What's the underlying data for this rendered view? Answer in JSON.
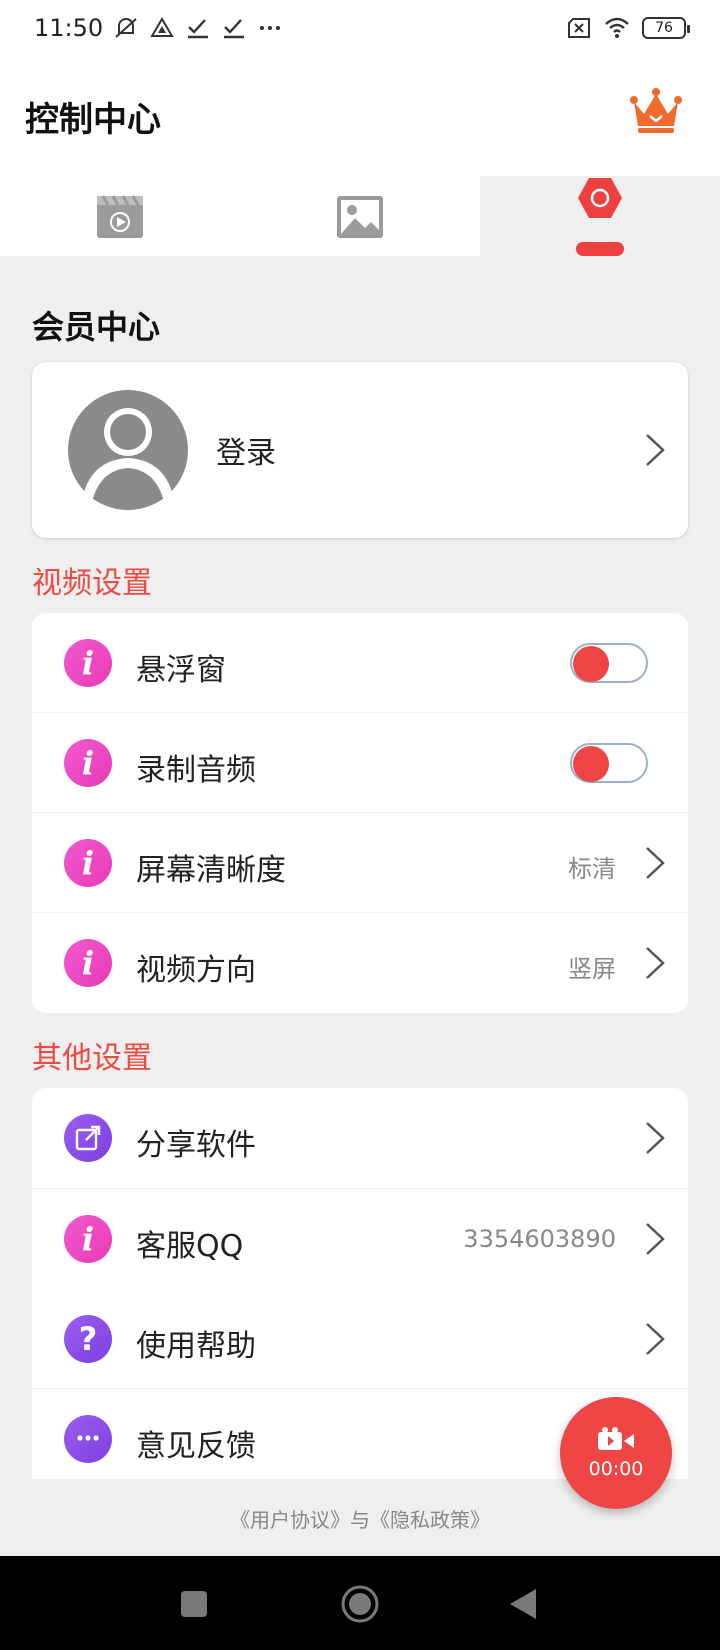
{
  "status_bar": {
    "time": "11:50",
    "battery": "76",
    "icons": [
      "mute-icon",
      "signal-icon",
      "check-icon",
      "check-icon",
      "more-icon",
      "sim-off-icon",
      "wifi-icon",
      "battery-icon"
    ]
  },
  "header": {
    "title": "控制中心",
    "crown_icon": "crown-icon",
    "crown_color": "#f06a2e"
  },
  "tabs": [
    {
      "icon": "video-icon",
      "active": false
    },
    {
      "icon": "image-icon",
      "active": false
    },
    {
      "icon": "hexagon-settings-icon",
      "active": true
    }
  ],
  "member": {
    "section_title": "会员中心",
    "login_label": "登录"
  },
  "video_settings": {
    "title": "视频设置",
    "items": [
      {
        "label": "悬浮窗",
        "control": "toggle",
        "on": false
      },
      {
        "label": "录制音频",
        "control": "toggle",
        "on": false
      },
      {
        "label": "屏幕清晰度",
        "value": "标清"
      },
      {
        "label": "视频方向",
        "value": "竖屏"
      }
    ]
  },
  "other_settings": {
    "title": "其他设置",
    "items": [
      {
        "label": "分享软件",
        "icon": "share-icon"
      },
      {
        "label": "客服QQ",
        "value": "3354603890",
        "icon": "info-icon"
      },
      {
        "label": "使用帮助",
        "icon": "help-icon"
      },
      {
        "label": "意见反馈",
        "icon": "chat-icon"
      }
    ]
  },
  "footer": {
    "links": "《用户协议》与《隐私政策》"
  },
  "fab": {
    "time": "00:00"
  },
  "colors": {
    "accent": "#ef4040",
    "section_red": "#ef4a3f",
    "pink_icon": "#e94bc3",
    "purple_icon": "#8a4be6"
  }
}
